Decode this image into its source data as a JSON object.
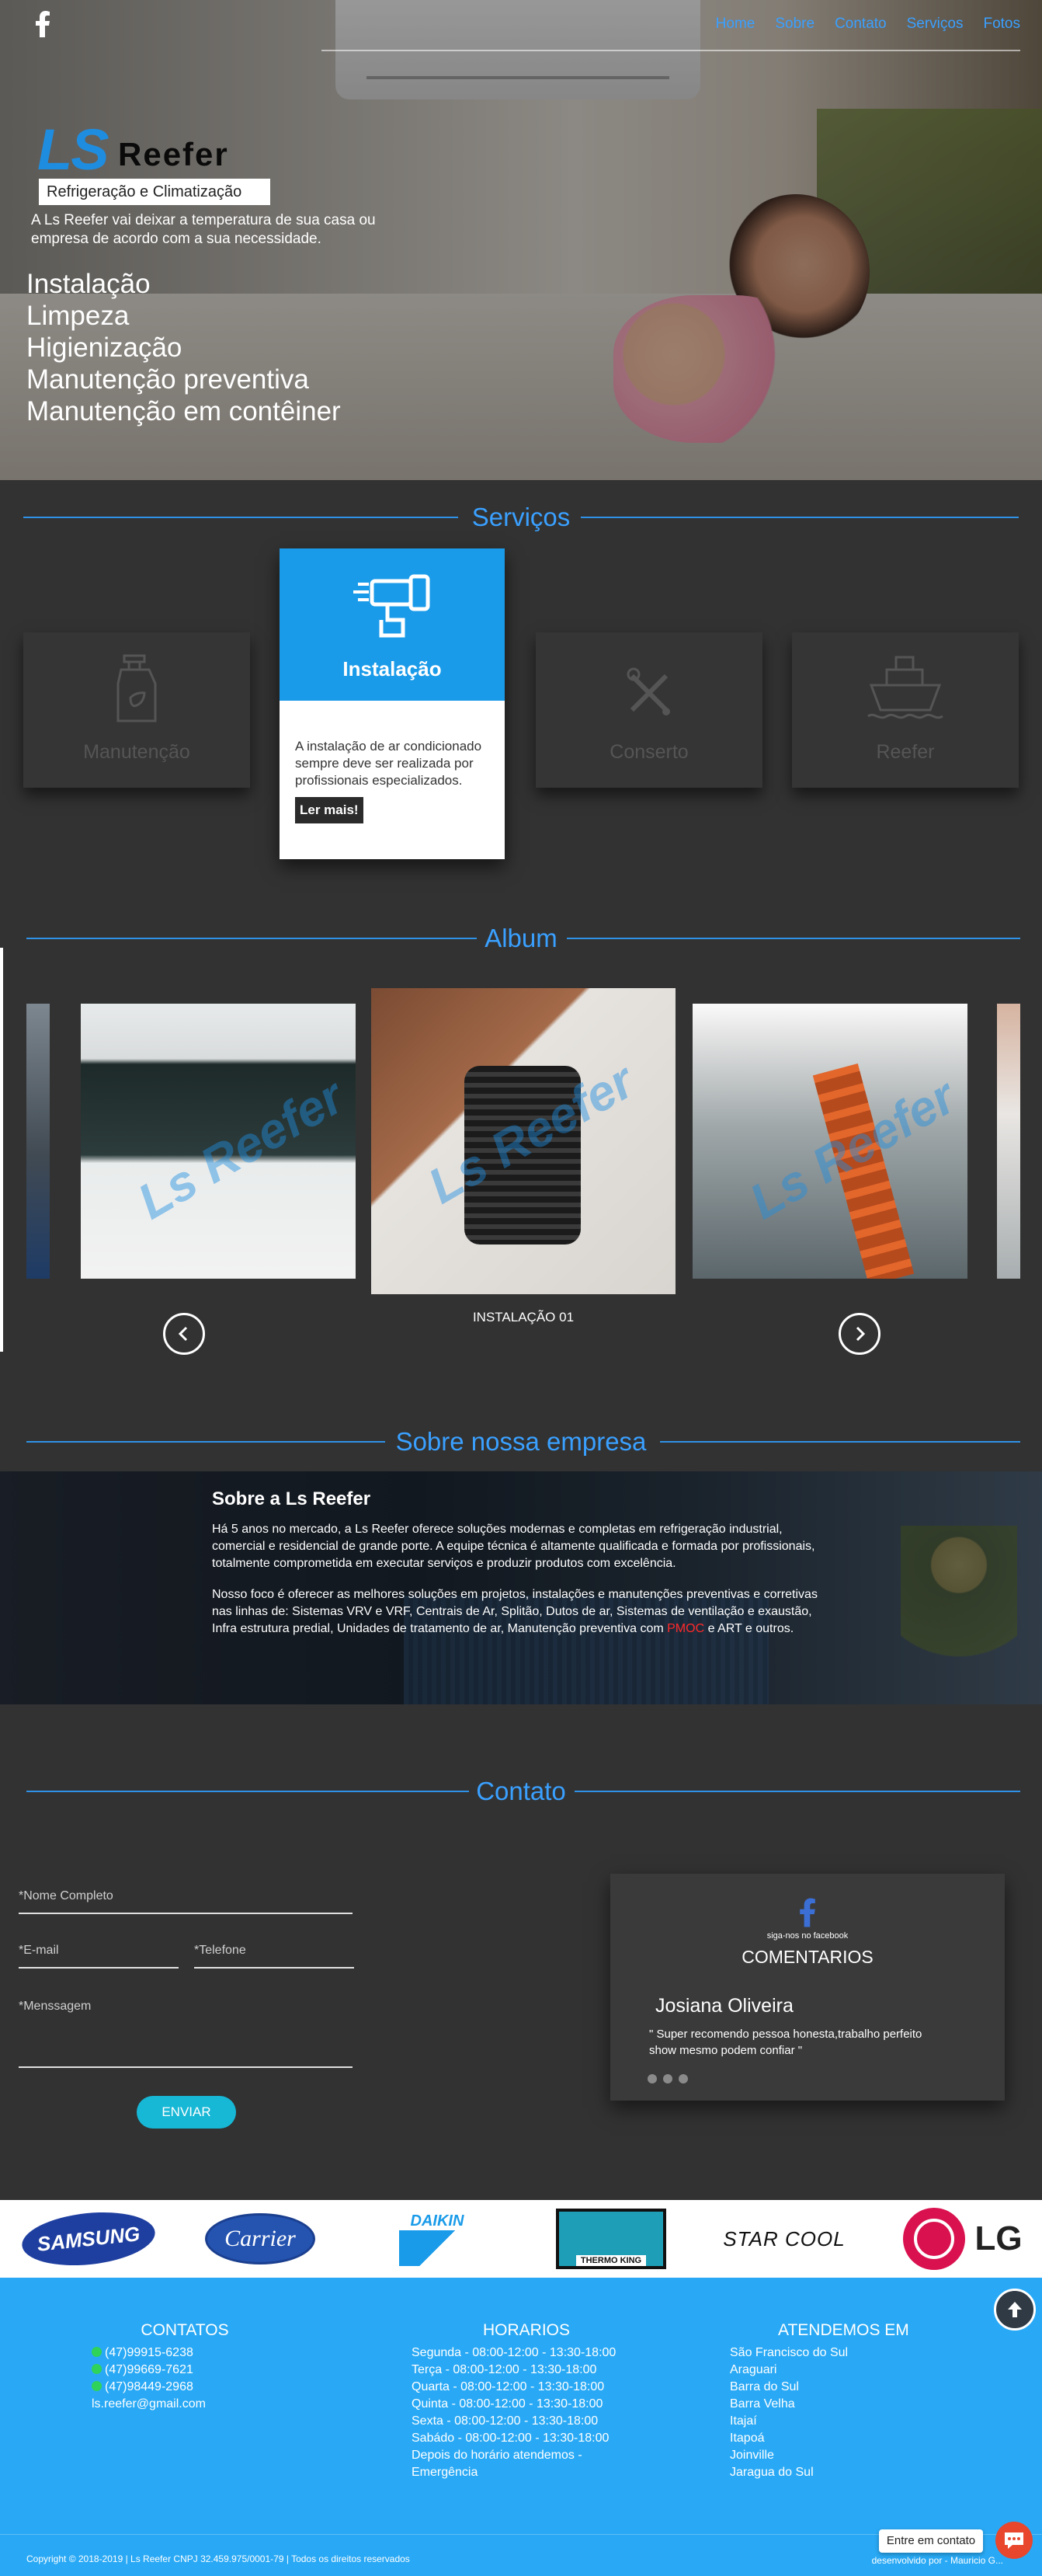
{
  "nav": {
    "links": [
      "Home",
      "Sobre",
      "Contato",
      "Serviços",
      "Fotos"
    ]
  },
  "hero": {
    "logo_ls": "LS",
    "logo_reefer": "Reefer",
    "logo_sub": "Refrigeração e Climatização",
    "tagline": "A Ls Reefer vai deixar a temperatura de sua casa ou empresa de acordo com a sua necessidade.",
    "services_list": [
      "Instalação",
      "Limpeza",
      "Higienização",
      "Manutenção preventiva",
      "Manutenção em contêiner"
    ]
  },
  "services": {
    "title": "Serviços",
    "cards": [
      {
        "label": "Manutenção",
        "icon": "spray-bottle-icon"
      },
      {
        "label": "Instalação",
        "icon": "drill-icon"
      },
      {
        "label": "Conserto",
        "icon": "tools-icon"
      },
      {
        "label": "Reefer",
        "icon": "ship-icon"
      }
    ],
    "active_description": "A instalação de ar condicionado sempre deve ser realizada por profissionais especializados.",
    "active_button": "Ler mais!"
  },
  "album": {
    "title": "Album",
    "caption": "INSTALAÇÃO 01",
    "watermark": "Ls Reefer"
  },
  "about": {
    "section_title": "Sobre nossa empresa",
    "heading": "Sobre a Ls Reefer",
    "p1": "Há 5 anos no mercado, a Ls Reefer oferece soluções modernas e completas em refrigeração industrial, comercial e residencial de grande porte. A equipe técnica é altamente qualificada e formada por profissionais, totalmente comprometida em executar serviços e produzir produtos com excelência.",
    "p2_a": "Nosso foco é oferecer as melhores soluções em projetos, instalações e manutenções preventivas e corretivas nas linhas de: Sistemas VRV e VRF, Centrais de Ar, Splitão, Dutos de ar, Sistemas de ventilação e exaustão, Infra estrutura predial, Unidades de tratamento de ar, Manutenção preventiva com",
    "p2_pmoc": "PMOC",
    "p2_b": "e ART e outros."
  },
  "contact": {
    "title": "Contato",
    "name_label": "*Nome Completo",
    "email_label": "*E-mail",
    "phone_label": "*Telefone",
    "message_label": "*Menssagem",
    "send": "ENVIAR",
    "fb_follow": "siga-nos no facebook",
    "comments_title": "COMENTARIOS",
    "comment_name": "Josiana Oliveira",
    "comment_text": "\" Super recomendo pessoa honesta,trabalho perfeito show mesmo podem confiar \""
  },
  "brands": [
    "SAMSUNG",
    "Carrier",
    "DAIKIN",
    "THERMO KING",
    "STAR COOL",
    "LG"
  ],
  "footer": {
    "contatos_title": "CONTATOS",
    "contatos": [
      "(47)99915-6238",
      "(47)99669-7621",
      "(47)98449-2968"
    ],
    "email": "ls.reefer@gmail.com",
    "horarios_title": "HORARIOS",
    "horarios": [
      "Segunda - 08:00-12:00 - 13:30-18:00",
      "Terça - 08:00-12:00 - 13:30-18:00",
      "Quarta - 08:00-12:00 - 13:30-18:00",
      "Quinta - 08:00-12:00 - 13:30-18:00",
      "Sexta - 08:00-12:00 - 13:30-18:00",
      "Sabádo - 08:00-12:00 - 13:30-18:00",
      "Depois do horário atendemos -",
      "Emergência"
    ],
    "atendemos_title": "ATENDEMOS EM",
    "cidades": [
      "São Francisco do Sul",
      "Araguari",
      "Barra do Sul",
      "Barra Velha",
      "Itajaí",
      "Itapoá",
      "Joinville",
      "Jaragua do Sul"
    ],
    "copyright": "Copyright © 2018-2019 | Ls Reefer CNPJ 32.459.975/0001-79 | Todos os direitos reservados",
    "dev": "desenvolvido por - Mauricio G...",
    "chat": "Entre em contato"
  },
  "colors": {
    "accent": "#3aa0ff",
    "footer": "#29a9f5",
    "active_card": "#1a9be9",
    "background": "#323232"
  }
}
